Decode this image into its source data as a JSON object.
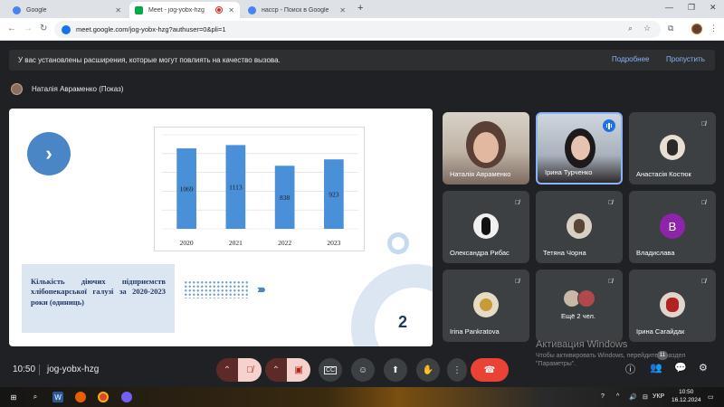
{
  "browser": {
    "tabs": [
      {
        "title": "Google",
        "favicon_color": "#4285f4",
        "active": false
      },
      {
        "title": "Meet - jog-yobx-hzg",
        "favicon_color": "#00ac47",
        "active": true,
        "recording": true
      },
      {
        "title": "насср - Поиск в Google",
        "favicon_color": "#4285f4",
        "active": false
      }
    ],
    "url": "meet.google.com/jog-yobx-hzg?authuser=0&pli=1"
  },
  "banner": {
    "text": "У вас установлены расширения, которые могут повлиять на качество вызова.",
    "more_label": "Подробнее",
    "dismiss_label": "Пропустить"
  },
  "presenter": {
    "label": "Наталія Авраменко (Показ)"
  },
  "slide": {
    "caption": "Кількість діючих підприємств хлібопекарської галузі за 2020-2023 роки (одиниць)",
    "page_number": "2",
    "next_icon": "chevron-right-icon"
  },
  "chart_data": {
    "type": "bar",
    "categories": [
      "2020",
      "2021",
      "2022",
      "2023"
    ],
    "values": [
      1069,
      1113,
      838,
      923
    ],
    "title": "",
    "xlabel": "",
    "ylabel": "",
    "ylim": [
      0,
      1250
    ],
    "grid": true,
    "bar_color": "#4a90d9"
  },
  "participants": [
    {
      "name": "Наталія Авраменко",
      "type": "video",
      "muted": false
    },
    {
      "name": "Ірина Турченко",
      "type": "video",
      "muted": false,
      "speaking": true
    },
    {
      "name": "Анастасія Костюк",
      "type": "avatar",
      "muted": true
    },
    {
      "name": "Олександра Рибас",
      "type": "avatar",
      "muted": true
    },
    {
      "name": "Тетяна Чорна",
      "type": "avatar",
      "muted": true
    },
    {
      "name": "Владислава",
      "type": "letter",
      "letter": "B",
      "color": "#8e24aa",
      "muted": true
    },
    {
      "name": "Irina Pankratova",
      "type": "avatar",
      "muted": true
    },
    {
      "name": "Ещё 2 чел.",
      "type": "more",
      "muted": true
    },
    {
      "name": "Ірина Сагайдак",
      "type": "avatar",
      "muted": true
    }
  ],
  "watermark": {
    "title": "Активация Windows",
    "text": "Чтобы активировать Windows, перейдите в раздел \"Параметры\"."
  },
  "controls": {
    "time": "10:50",
    "meeting_code": "jog-yobx-hzg",
    "people_count": "11"
  },
  "taskbar": {
    "lang": "УКР",
    "time": "10:50",
    "date": "16.12.2024"
  }
}
